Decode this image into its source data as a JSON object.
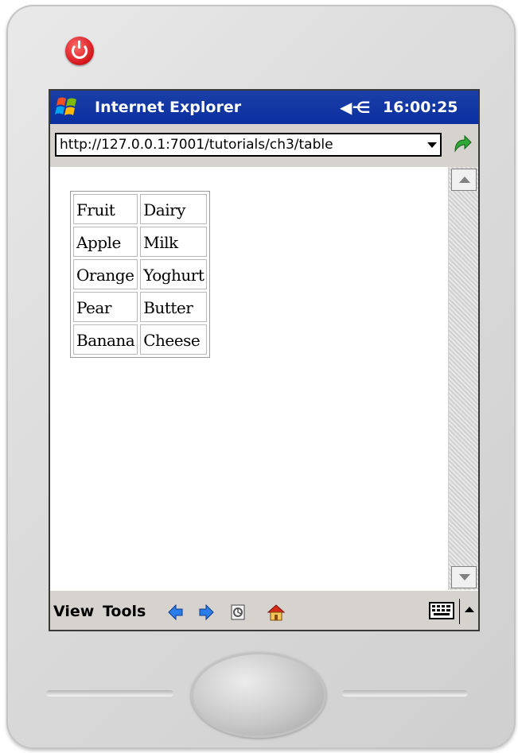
{
  "titlebar": {
    "app_title": "Internet Explorer",
    "clock": "16:00:25",
    "speaker_icon": "speaker-muted-icon"
  },
  "addressbar": {
    "url": "http://127.0.0.1:7001/tutorials/ch3/table"
  },
  "table": {
    "rows": [
      [
        "Fruit",
        "Dairy"
      ],
      [
        "Apple",
        "Milk"
      ],
      [
        "Orange",
        "Yoghurt"
      ],
      [
        "Pear",
        "Butter"
      ],
      [
        "Banana",
        "Cheese"
      ]
    ]
  },
  "menubar": {
    "view_label": "View",
    "tools_label": "Tools",
    "icons": [
      "back-icon",
      "forward-icon",
      "favorites-icon",
      "home-icon",
      "keyboard-icon"
    ]
  },
  "colors": {
    "titlebar": "#0a2fa0",
    "chrome": "#d6d3ce",
    "power_button": "#d4141a"
  }
}
